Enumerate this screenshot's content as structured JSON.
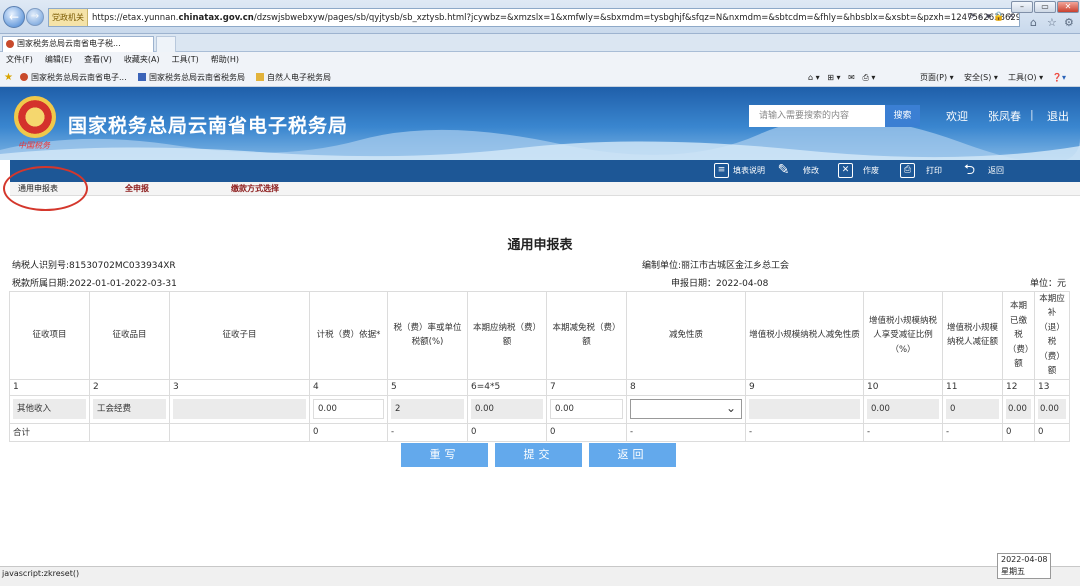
{
  "browser": {
    "url_prefix": "https://etax.yunnan.",
    "url_host": "chinatax.gov.cn",
    "url_rest": "/dzswjsbwebxyw/pages/sb/qyjtysb/sb_xztysb.html?jcywbz=&xmzslx=1&xmfwly=&sbxmdm=tysbghjf&sfqz=N&nxmdm=&sbtcdm=&fhly=&hbsblx=&xsbt=&pzxh=1247562638629",
    "gov_badge": "党政机关",
    "tab_title": "国家税务总局云南省电子税...",
    "menu": [
      "文件(F)",
      "编辑(E)",
      "查看(V)",
      "收藏夹(A)",
      "工具(T)",
      "帮助(H)"
    ],
    "favorites": [
      "国家税务总局云南省电子...",
      "国家税务总局云南省税务局",
      "自然人电子税务局"
    ],
    "commands": {
      "page": "页面(P) ▾",
      "safety": "安全(S) ▾",
      "tools": "工具(O) ▾"
    }
  },
  "header": {
    "site_title": "国家税务总局云南省电子税务局",
    "emblem_caption": "中国税务",
    "search_placeholder": "请输入需要搜索的内容",
    "search_button": "搜索",
    "welcome": "欢迎",
    "user": "张凤春",
    "logout": "退出"
  },
  "toolbar": {
    "help": "填表说明",
    "edit": "修改",
    "void": "作废",
    "print": "打印",
    "back": "返回"
  },
  "subtabs": [
    "通用申报表",
    "全申报",
    "缴款方式选择"
  ],
  "form": {
    "title": "通用申报表",
    "taxpayer_id": "纳税人识别号:81530702MC033934XR",
    "unit": "编制单位:丽江市古城区金江乡总工会",
    "period": "税款所属日期:2022-01-01-2022-03-31",
    "report_date": "申报日期：2022-04-08",
    "currency": "单位：元",
    "columns": [
      "征收项目",
      "征收品目",
      "征收子目",
      "计税（费）依据*",
      "税（费）率或单位税额(%)",
      "本期应纳税（费）额",
      "本期减免税（费）额",
      "减免性质",
      "增值税小规模纳税人减免性质",
      "增值税小规模纳税人享受减征比例（%）",
      "增值税小规模纳税人减征额",
      "本期已缴税（费）额",
      "本期应补（退）税（费）额"
    ],
    "numbers": [
      "1",
      "2",
      "3",
      "4",
      "5",
      "6=4*5",
      "7",
      "8",
      "9",
      "10",
      "11",
      "12",
      "13"
    ],
    "row": {
      "item": "其他收入",
      "subitem": "工会经费",
      "sub2": "",
      "basis": "0.00",
      "rate": "2",
      "payable": "0.00",
      "relief": "0.00",
      "relief_type": "",
      "vat_type": "",
      "vat_ratio": "0.00",
      "vat_relief": "0",
      "paid": "0.00",
      "due": "0.00"
    },
    "total": {
      "label": "合计",
      "basis": "0",
      "rate": "-",
      "payable": "0",
      "relief": "0",
      "relief_type": "-",
      "vat_type": "-",
      "vat_ratio": "-",
      "vat_relief": "-",
      "paid": "0",
      "due": "0"
    }
  },
  "buttons": {
    "reset": "重写",
    "submit": "提交",
    "back": "返回"
  },
  "status": {
    "text": "javascript:zkreset()",
    "date": "2022-04-08",
    "weekday": "星期五"
  }
}
